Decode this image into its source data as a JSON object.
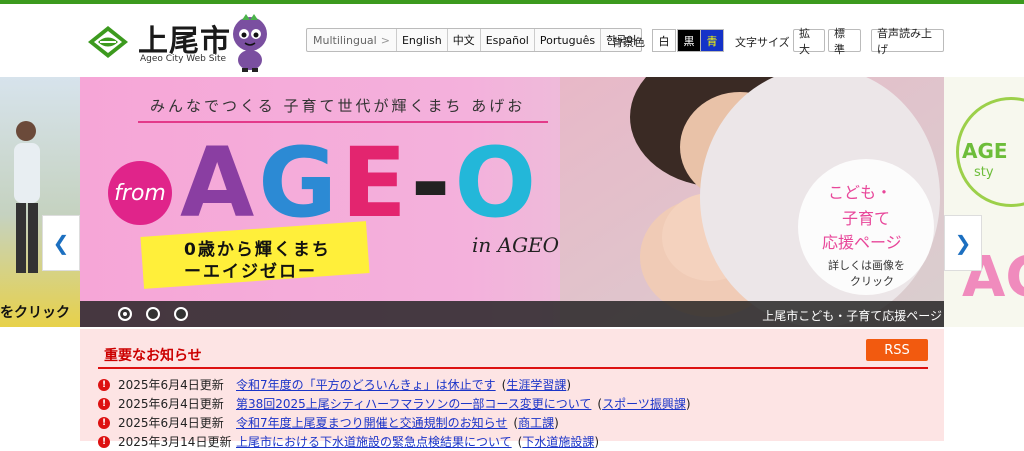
{
  "header": {
    "site_title": "上尾市",
    "site_subtitle": "Ageo City Web Site"
  },
  "language": {
    "label": "Multilingual",
    "options": [
      "English",
      "中文",
      "Español",
      "Português",
      "한국어"
    ]
  },
  "background": {
    "label": "背景色",
    "white": "白",
    "black": "黒",
    "blue": "青"
  },
  "font_size": {
    "label": "文字サイズ",
    "enlarge": "拡大",
    "standard": "標準"
  },
  "voice_button": "音声読み上げ",
  "slider": {
    "left_text": "をクリック",
    "tagline": "みんなでつくる 子育て世代が輝くまち あげお",
    "from": "from",
    "ageo_a": "A",
    "ageo_g": "G",
    "ageo_e": "E",
    "ageo_dash": "-",
    "ageo_o": "O",
    "yellow_line1": "0歳から輝くまち",
    "yellow_line2": "ーエイジゼロー",
    "in_ageo": "in AGEO",
    "info_line1": "こども・",
    "info_line2": "子育て",
    "info_line3": "応援ページ",
    "info_line4": "詳しくは画像を",
    "info_line5": "クリック",
    "caption": "上尾市こども・子育て応援ページ",
    "right_text1": "AGE",
    "right_text2": "sty",
    "right_text3": "AG",
    "prev": "❮",
    "next": "❯",
    "active_dot": 1
  },
  "notice": {
    "title": "重要なお知らせ",
    "rss": "RSS",
    "items": [
      {
        "date": "2025年6月4日更新",
        "title": "令和7年度の「平方のどろいんきょ」は休止です",
        "category": "生涯学習課"
      },
      {
        "date": "2025年6月4日更新",
        "title": "第38回2025上尾シティハーフマラソンの一部コース変更について",
        "category": "スポーツ振興課"
      },
      {
        "date": "2025年6月4日更新",
        "title": "令和7年度上尾夏まつり開催と交通規制のお知らせ",
        "category": "商工課"
      },
      {
        "date": "2025年3月14日更新",
        "title": "上尾市における下水道施設の緊急点検結果について",
        "category": "下水道施設課"
      }
    ]
  },
  "colors": {
    "brand_green": "#3c9a1e",
    "notice_red": "#dd1111",
    "rss_orange": "#f25a0f",
    "link_blue": "#1b34c8"
  }
}
